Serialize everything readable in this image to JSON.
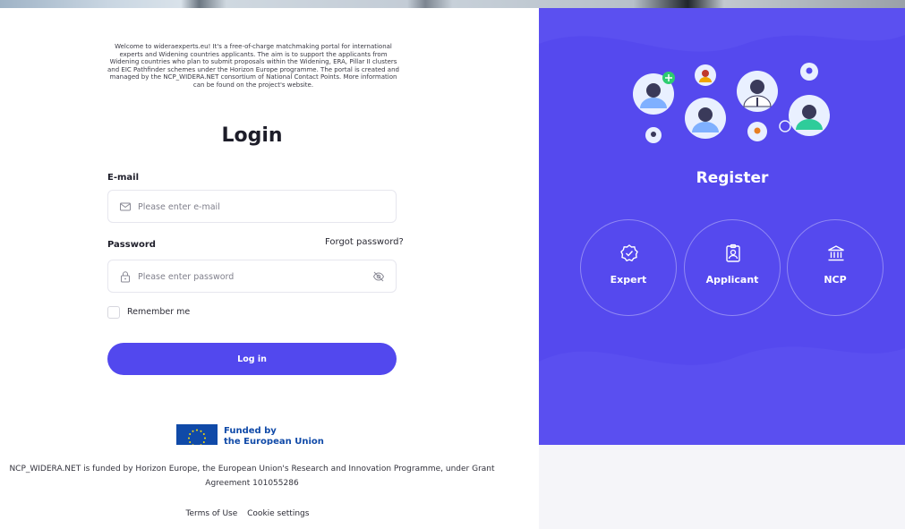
{
  "intro": {
    "text": "Welcome to wideraexperts.eu! It's a free-of-charge matchmaking portal for international experts and Widening countries applicants. The aim is to support the applicants from Widening countries who plan to submit proposals within the Widening, ERA, Pillar II clusters and EIC Pathfinder schemes under the Horizon Europe programme. The portal is created and managed by the NCP_WIDERA.NET consortium of National Contact Points. More information can be found on the project's website."
  },
  "login": {
    "title": "Login",
    "email_label": "E-mail",
    "email_placeholder": "Please enter e-mail",
    "password_label": "Password",
    "password_placeholder": "Please enter password",
    "forgot_password": "Forgot password?",
    "remember_me": "Remember me",
    "submit_label": "Log in"
  },
  "eu": {
    "funded_line1": "Funded by",
    "funded_line2": "the European Union"
  },
  "register": {
    "title": "Register",
    "options": [
      {
        "label": "Expert",
        "icon": "badge-check-icon"
      },
      {
        "label": "Applicant",
        "icon": "id-card-icon"
      },
      {
        "label": "NCP",
        "icon": "bank-icon"
      }
    ]
  },
  "footer": {
    "funding_text": "NCP_WIDERA.NET is funded by Horizon Europe, the European Union's Research and Innovation Programme, under Grant Agreement 101055286",
    "links": [
      "Terms of Use",
      "Cookie settings"
    ]
  },
  "colors": {
    "accent": "#5248ee",
    "register_panel": "#5549ee",
    "eu_blue": "#104aa8"
  }
}
